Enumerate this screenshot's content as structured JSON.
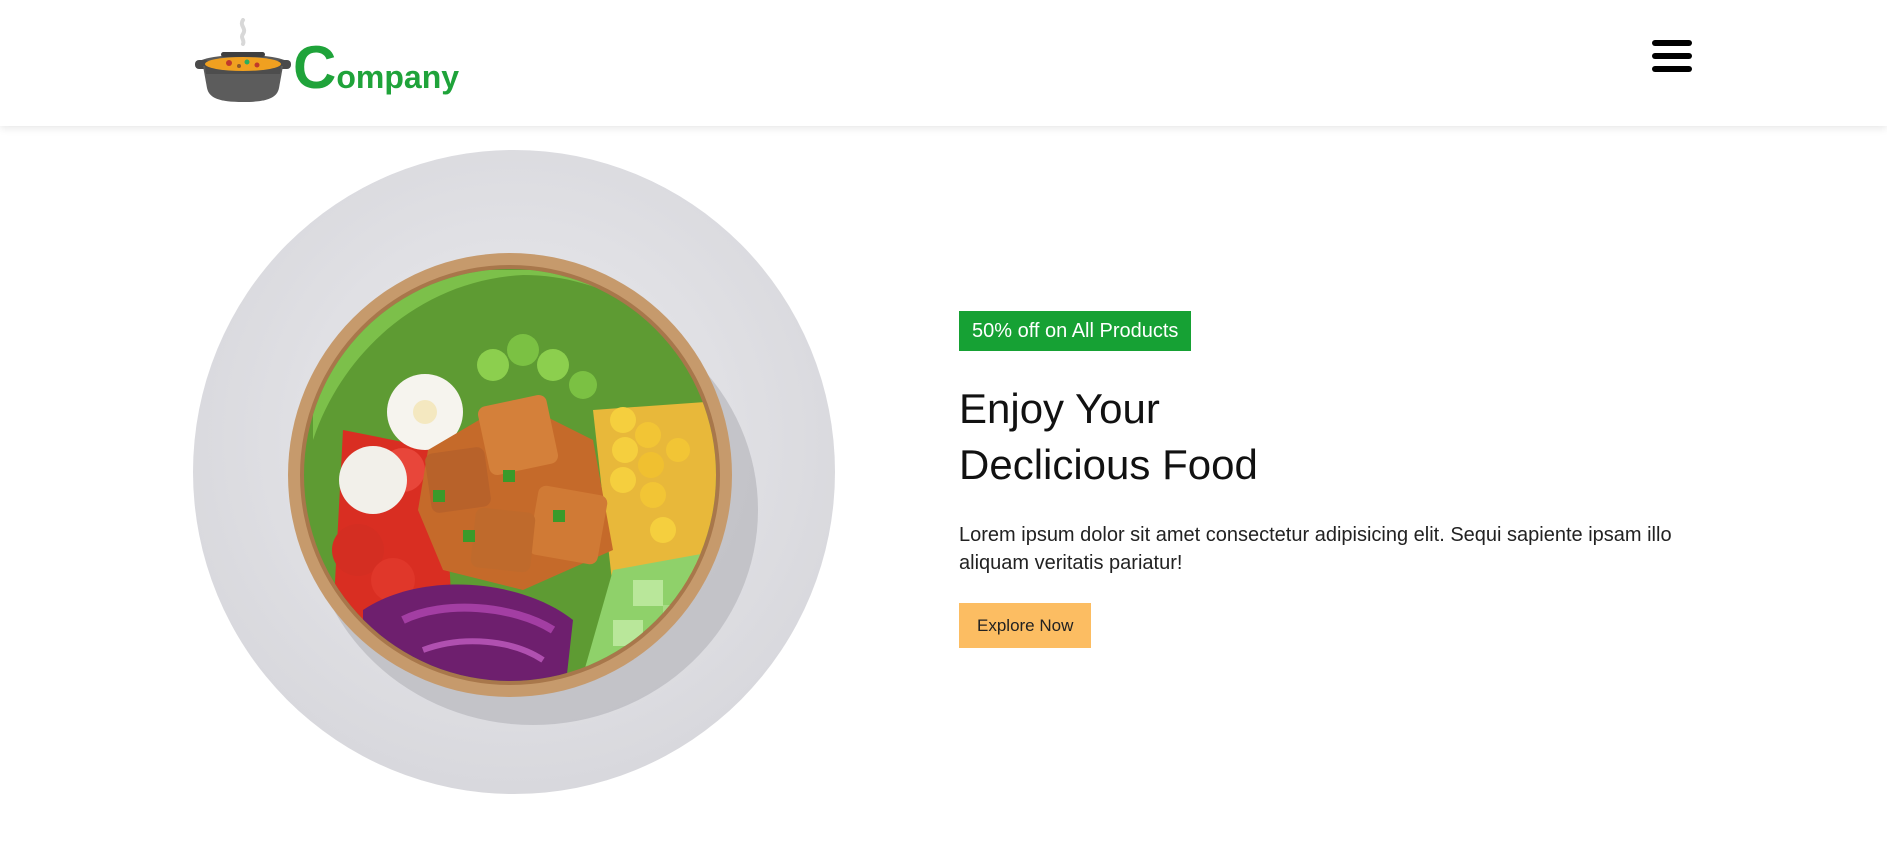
{
  "header": {
    "logo": {
      "first_letter": "C",
      "rest": "ompany",
      "icon": "soup-pot-icon"
    },
    "menu_icon": "hamburger-menu-icon"
  },
  "hero": {
    "image": "salad-bowl-photo",
    "badge": "50% off on All Products",
    "headline_line1": "Enjoy Your",
    "headline_line2": "Declicious Food",
    "description": "Lorem ipsum dolor sit amet consectetur adipisicing elit. Sequi sapiente ipsam illo aliquam veritatis pariatur!",
    "cta_label": "Explore Now"
  },
  "colors": {
    "brand_green": "#16a134",
    "cta_orange": "#fcbd62",
    "text": "#111111",
    "background": "#ffffff"
  }
}
